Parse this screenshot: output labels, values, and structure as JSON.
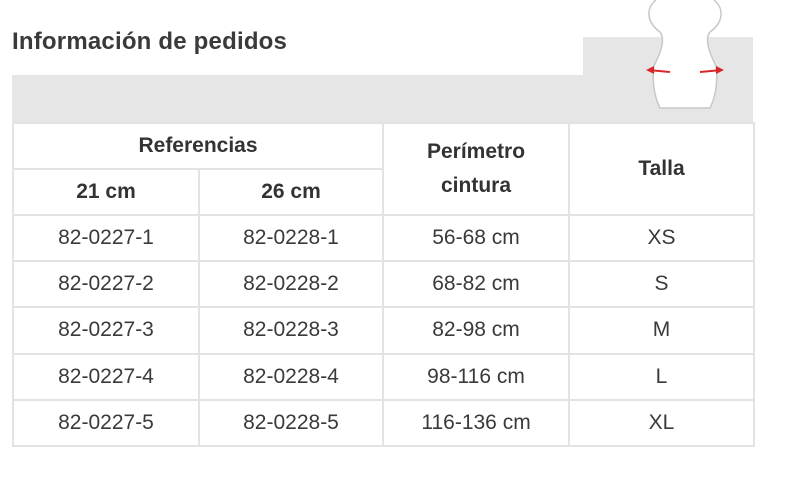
{
  "title": "Información de pedidos",
  "table": {
    "headers": {
      "referencias": "Referencias",
      "sub_21": "21 cm",
      "sub_26": "26 cm",
      "perimetro": "Perímetro cintura",
      "talla": "Talla"
    },
    "rows": [
      [
        "82-0227-1",
        "82-0228-1",
        "56-68 cm",
        "XS"
      ],
      [
        "82-0227-2",
        "82-0228-2",
        "68-82 cm",
        "S"
      ],
      [
        "82-0227-3",
        "82-0228-3",
        "82-98 cm",
        "M"
      ],
      [
        "82-0227-4",
        "82-0228-4",
        "98-116 cm",
        "L"
      ],
      [
        "82-0227-5",
        "82-0228-5",
        "116-136 cm",
        "XL"
      ]
    ]
  },
  "colors": {
    "accent_arrow": "#d9262c",
    "band_gray": "#e6e6e6"
  },
  "icons": [
    "waist-measurement-icon"
  ]
}
